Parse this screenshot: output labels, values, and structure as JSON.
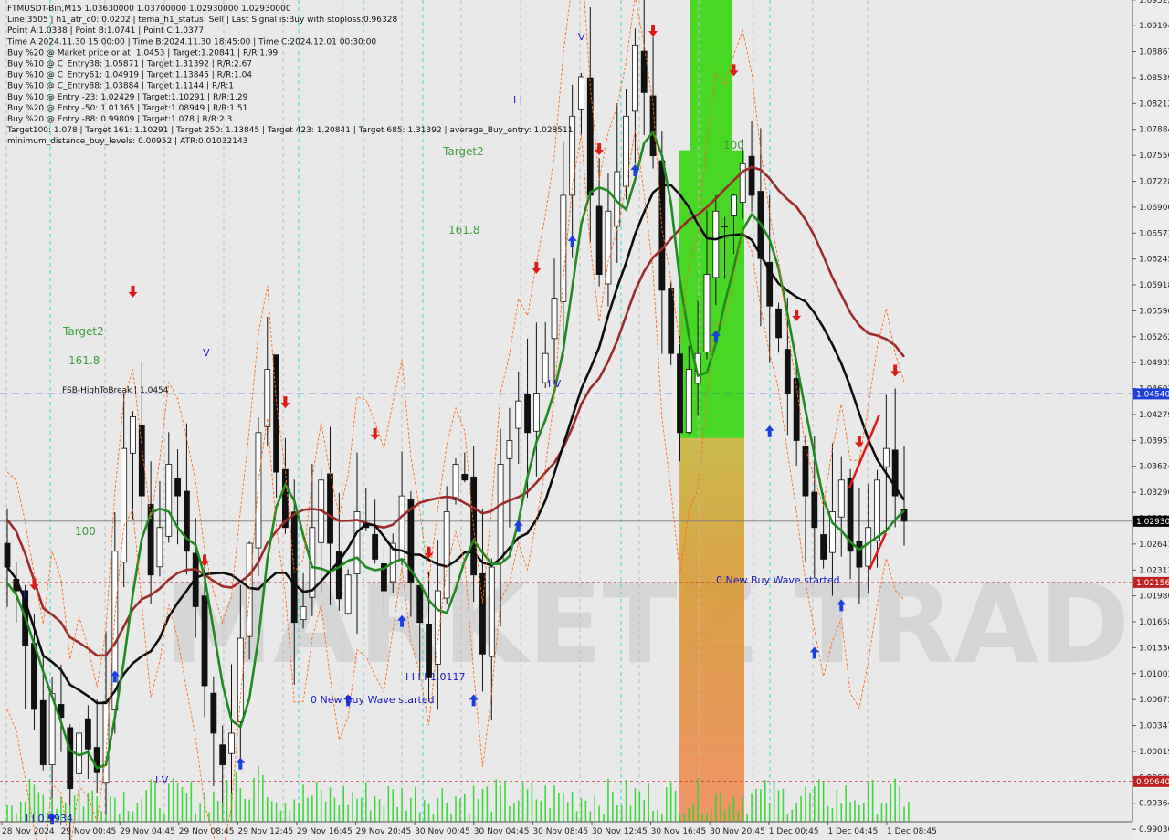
{
  "header": {
    "lines": [
      "FTMUSDT-Bin,M15  1.03630000 1.03700000 1.02930000 1.02930000",
      "Line:3505 | h1_atr_c0: 0.0202 | tema_h1_status: Sell | Last Signal is:Buy with stoploss:0.96328",
      "Point A:1.0338 | Point B:1.0741 | Point C:1.0377",
      "Time A:2024.11.30 15:00:00 | Time B:2024.11.30 18:45:00 | Time C:2024.12.01 00:30:00",
      "Buy %20 @ Market price or at: 1.0453 | Target:1.20841 | R/R:1.99",
      "Buy %10 @ C_Entry38: 1.05871 | Target:1.31392 | R/R:2.67",
      "Buy %10 @ C_Entry61: 1.04919 | Target:1.13845 | R/R:1.04",
      "Buy %10 @ C_Entry88: 1.03884 | Target:1.1144 | R/R:1",
      "Buy %10 @ Entry -23: 1.02429 | Target:1.10291 | R/R:1.29",
      "Buy %20 @ Entry -50: 1.01365 | Target:1.08949 | R/R:1.51",
      "Buy %20 @ Entry -88: 0.99809 | Target:1.078 | R/R:2.3",
      "Target100: 1.078 | Target 161: 1.10291 | Target 250: 1.13845 | Target 423: 1.20841 | Target 685: 1.31392 | average_Buy_entry: 1.028511",
      "minimum_distance_buy_levels: 0.00952 | ATR:0.01032143"
    ]
  },
  "watermark": "MARKETZ TRADE",
  "chart_data": {
    "type": "candlestick",
    "symbol": "FTMUSDT-Bin",
    "timeframe": "M15",
    "ylim": [
      0.9913,
      1.0952
    ],
    "y_ticks": [
      1.09522,
      1.09194,
      1.08867,
      1.08539,
      1.08212,
      1.07884,
      1.07556,
      1.07228,
      1.069,
      1.06573,
      1.06245,
      1.05918,
      1.0559,
      1.05262,
      1.04935,
      1.04607,
      1.04279,
      1.03951,
      1.03624,
      1.03296,
      1.02969,
      1.02641,
      1.02313,
      1.01986,
      1.01658,
      1.0133,
      1.01003,
      1.00675,
      1.00347,
      1.00019,
      0.99691,
      0.99364,
      0.99036
    ],
    "x_ticks": [
      "28 Nov 2024",
      "29 Nov 00:45",
      "29 Nov 04:45",
      "29 Nov 08:45",
      "29 Nov 12:45",
      "29 Nov 16:45",
      "29 Nov 20:45",
      "30 Nov 00:45",
      "30 Nov 04:45",
      "30 Nov 08:45",
      "30 Nov 12:45",
      "30 Nov 16:45",
      "30 Nov 20:45",
      "1 Dec 00:45",
      "1 Dec 04:45",
      "1 Dec 08:45"
    ],
    "highlight_prices": [
      {
        "label": "1.04540",
        "value": 1.0454,
        "color": "#1e3fe0"
      },
      {
        "label": "1.02930",
        "value": 1.0293,
        "color": "#000000"
      },
      {
        "label": "1.02156",
        "value": 1.02156,
        "color": "#c02020"
      },
      {
        "label": "0.99640",
        "value": 0.9964,
        "color": "#c02020"
      }
    ],
    "close_series": [
      1.0235,
      1.0205,
      1.0135,
      1.0055,
      0.9985,
      1.0075,
      1.0045,
      0.9955,
      1.0025,
      1.0005,
      0.9975,
      1.0065,
      1.0255,
      1.0385,
      1.0425,
      1.0325,
      1.0225,
      1.0285,
      1.0365,
      1.0325,
      1.0255,
      1.0185,
      1.0085,
      1.0025,
      0.9985,
      1.0025,
      1.0145,
      1.0265,
      1.0405,
      1.0485,
      1.0355,
      1.0285,
      1.0165,
      1.0185,
      1.0285,
      1.0345,
      1.0265,
      1.0195,
      1.0225,
      1.0305,
      1.0285,
      1.0245,
      1.0205,
      1.0265,
      1.0325,
      1.0215,
      1.0165,
      1.0095,
      1.0205,
      1.0305,
      1.0365,
      1.0345,
      1.0225,
      1.0125,
      1.0235,
      1.0365,
      1.0395,
      1.0445,
      1.0405,
      1.0455,
      1.0505,
      1.0575,
      1.0705,
      1.0805,
      1.0855,
      1.0705,
      1.0605,
      1.0685,
      1.0735,
      1.0805,
      1.0895,
      1.0835,
      1.0755,
      1.0585,
      1.0505,
      1.0405,
      1.0485,
      1.0505,
      1.0605,
      1.0685,
      1.0665,
      1.0705,
      1.0745,
      1.0705,
      1.0625,
      1.0565,
      1.0525,
      1.0455,
      1.0395,
      1.0325,
      1.0285,
      1.0245,
      1.0305,
      1.0345,
      1.0255,
      1.0235,
      1.0285,
      1.0345,
      1.0385,
      1.0325,
      1.0293
    ],
    "ma_series": [
      {
        "name": "",
        "color": "#9c2a2a"
      },
      {
        "name": "",
        "color": "#0c0c0c"
      },
      {
        "name": "",
        "color": "#1f8a1f"
      }
    ],
    "zones": [
      {
        "name": "buy-zone",
        "from": 1.0398,
        "to": 1.0952,
        "color": "#3fd61a"
      },
      {
        "name": "target-zone",
        "from": 0.9913,
        "to": 1.0398,
        "color": "#e59a2c"
      }
    ],
    "annotations": [
      {
        "text": "Target2",
        "kind": "fib"
      },
      {
        "text": "161.8",
        "kind": "fib"
      },
      {
        "text": "Target2",
        "kind": "fib"
      },
      {
        "text": "161.8",
        "kind": "fib"
      },
      {
        "text": "100",
        "kind": "fib"
      },
      {
        "text": "100",
        "kind": "fib"
      },
      {
        "text": "FSB-HighToBreak | 1.0454",
        "kind": "level"
      },
      {
        "text": "0 New Buy Wave started",
        "kind": "wave"
      },
      {
        "text": "0 New Buy Wave started",
        "kind": "wave"
      },
      {
        "text": "I I I I 1.0117",
        "kind": "wave"
      },
      {
        "text": "I I 0.9934",
        "kind": "wave"
      },
      {
        "text": "I V",
        "kind": "wave"
      },
      {
        "text": "I I",
        "kind": "wave"
      },
      {
        "text": "I V",
        "kind": "wave"
      },
      {
        "text": "V",
        "kind": "wave"
      },
      {
        "text": "V",
        "kind": "wave"
      },
      {
        "text": "I",
        "kind": "wave"
      }
    ]
  }
}
